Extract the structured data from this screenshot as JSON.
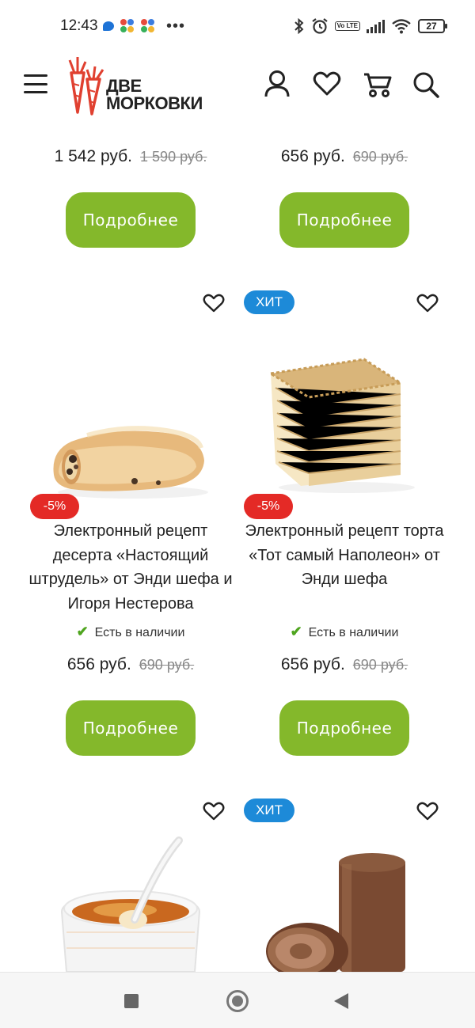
{
  "status_bar": {
    "time": "12:43",
    "battery": "27",
    "volte": "Vo LTE",
    "more": "•••"
  },
  "header": {
    "logo_line1": "ДВЕ",
    "logo_line2": "МОРКОВКИ",
    "icons": [
      "menu-icon",
      "user-icon",
      "heart-icon",
      "cart-icon",
      "search-icon"
    ]
  },
  "top_row": [
    {
      "price": "1 542 руб.",
      "old_price": "1 590 руб.",
      "button": "Подробнее"
    },
    {
      "price": "656 руб.",
      "old_price": "690 руб.",
      "button": "Подробнее"
    }
  ],
  "products": [
    {
      "badge": "",
      "discount": "-5%",
      "title_lines": [
        "Электронный рецепт",
        "десерта «Настоящий",
        "штрудель» от Энди шефа и",
        "Игоря Нестерова"
      ],
      "stock": "Есть в наличии",
      "price": "656 руб.",
      "old_price": "690 руб.",
      "button": "Подробнее",
      "image": "strudel"
    },
    {
      "badge": "ХИТ",
      "discount": "-5%",
      "title_lines": [
        "Электронный рецепт торта",
        "«Тот самый Наполеон» от",
        "Энди шефа"
      ],
      "stock": "Есть в наличии",
      "price": "656 руб.",
      "old_price": "690 руб.",
      "button": "Подробнее",
      "image": "napoleon-cake"
    }
  ],
  "bottom_row": [
    {
      "badge": "",
      "image": "creme-brulee"
    },
    {
      "badge": "ХИТ",
      "image": "chocolate-roll"
    }
  ],
  "colors": {
    "button_green": "#84b82b",
    "hit_blue": "#1d8ad8",
    "discount_red": "#e42a26",
    "stock_green": "#4fa51f"
  }
}
